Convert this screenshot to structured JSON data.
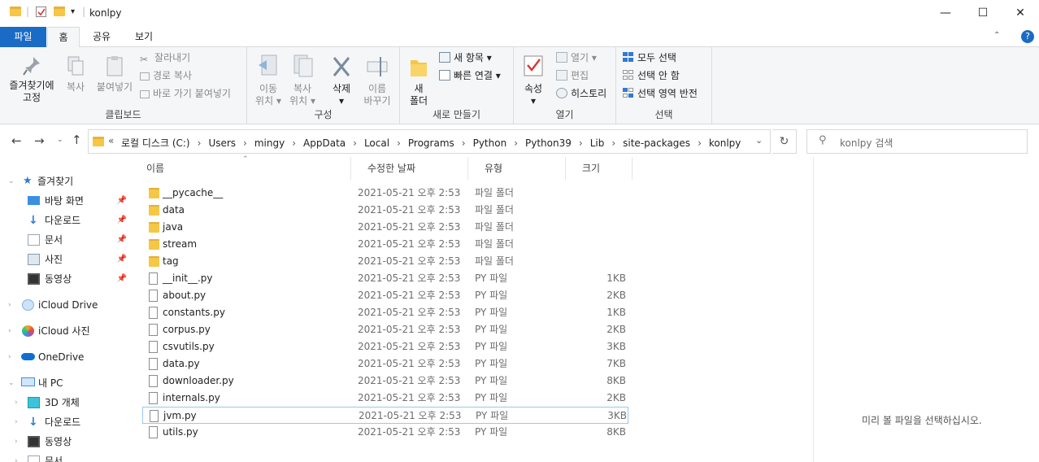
{
  "window": {
    "title": "konlpy"
  },
  "ribbon_tabs": [
    "파일",
    "홈",
    "공유",
    "보기"
  ],
  "clipboard": {
    "pin_label_1": "즐겨찾기에",
    "pin_label_2": "고정",
    "copy_label": "복사",
    "paste_label": "붙여넣기",
    "cut_label": "잘라내기",
    "copy_path_label": "경로 복사",
    "paste_shortcut_label": "바로 가기 붙여넣기",
    "group_label": "클립보드"
  },
  "organize": {
    "move_label_1": "이동",
    "move_label_2": "위치",
    "copyto_label_1": "복사",
    "copyto_label_2": "위치",
    "delete_label": "삭제",
    "rename_label_1": "이름",
    "rename_label_2": "바꾸기",
    "group_label": "구성"
  },
  "new": {
    "new_folder_label_1": "새",
    "new_folder_label_2": "폴더",
    "new_item_label": "새 항목",
    "easy_access_label": "빠른 연결",
    "group_label": "새로 만들기"
  },
  "open": {
    "properties_label": "속성",
    "open_label": "열기",
    "edit_label": "편집",
    "history_label": "히스토리",
    "group_label": "열기"
  },
  "select": {
    "select_all_label": "모두 선택",
    "select_none_label": "선택 안 함",
    "invert_label": "선택 영역 반전",
    "group_label": "선택"
  },
  "address": {
    "prefix": "«",
    "crumbs": [
      "로컬 디스크 (C:)",
      "Users",
      "mingy",
      "AppData",
      "Local",
      "Programs",
      "Python",
      "Python39",
      "Lib",
      "site-packages",
      "konlpy"
    ]
  },
  "search": {
    "placeholder": "konlpy 검색"
  },
  "navpane": {
    "quick_access": "즐겨찾기",
    "quick_items": [
      "바탕 화면",
      "다운로드",
      "문서",
      "사진",
      "동영상"
    ],
    "icloud_drive": "iCloud Drive",
    "icloud_photos": "iCloud 사진",
    "onedrive": "OneDrive",
    "this_pc": "내 PC",
    "pc_items": [
      "3D 개체",
      "다운로드",
      "동영상",
      "문서"
    ]
  },
  "columns": {
    "name": "이름",
    "date": "수정한 날짜",
    "type": "유형",
    "size": "크기"
  },
  "files": [
    {
      "name": "__pycache__",
      "date": "2021-05-21 오후 2:53",
      "type": "파일 폴더",
      "size": "",
      "kind": "folder"
    },
    {
      "name": "data",
      "date": "2021-05-21 오후 2:53",
      "type": "파일 폴더",
      "size": "",
      "kind": "folder"
    },
    {
      "name": "java",
      "date": "2021-05-21 오후 2:53",
      "type": "파일 폴더",
      "size": "",
      "kind": "folder"
    },
    {
      "name": "stream",
      "date": "2021-05-21 오후 2:53",
      "type": "파일 폴더",
      "size": "",
      "kind": "folder"
    },
    {
      "name": "tag",
      "date": "2021-05-21 오후 2:53",
      "type": "파일 폴더",
      "size": "",
      "kind": "folder"
    },
    {
      "name": "__init__.py",
      "date": "2021-05-21 오후 2:53",
      "type": "PY 파일",
      "size": "1KB",
      "kind": "file"
    },
    {
      "name": "about.py",
      "date": "2021-05-21 오후 2:53",
      "type": "PY 파일",
      "size": "2KB",
      "kind": "file"
    },
    {
      "name": "constants.py",
      "date": "2021-05-21 오후 2:53",
      "type": "PY 파일",
      "size": "1KB",
      "kind": "file"
    },
    {
      "name": "corpus.py",
      "date": "2021-05-21 오후 2:53",
      "type": "PY 파일",
      "size": "2KB",
      "kind": "file"
    },
    {
      "name": "csvutils.py",
      "date": "2021-05-21 오후 2:53",
      "type": "PY 파일",
      "size": "3KB",
      "kind": "file"
    },
    {
      "name": "data.py",
      "date": "2021-05-21 오후 2:53",
      "type": "PY 파일",
      "size": "7KB",
      "kind": "file"
    },
    {
      "name": "downloader.py",
      "date": "2021-05-21 오후 2:53",
      "type": "PY 파일",
      "size": "8KB",
      "kind": "file"
    },
    {
      "name": "internals.py",
      "date": "2021-05-21 오후 2:53",
      "type": "PY 파일",
      "size": "2KB",
      "kind": "file"
    },
    {
      "name": "jvm.py",
      "date": "2021-05-21 오후 2:53",
      "type": "PY 파일",
      "size": "3KB",
      "kind": "file",
      "selected": true
    },
    {
      "name": "utils.py",
      "date": "2021-05-21 오후 2:53",
      "type": "PY 파일",
      "size": "8KB",
      "kind": "file"
    }
  ],
  "preview": {
    "message": "미리 볼 파일을 선택하십시오."
  },
  "colors": {
    "accent": "#1a6bc6",
    "folder": "#f6c744",
    "selection_border": "#99c9ef"
  }
}
